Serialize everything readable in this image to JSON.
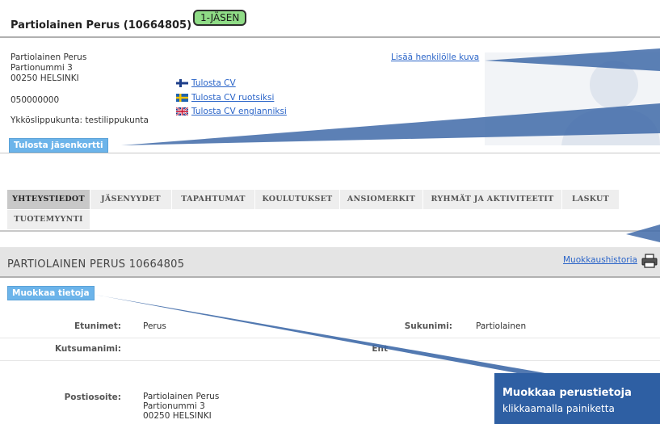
{
  "header": {
    "title": "Partiolainen Perus (10664805)",
    "badge": "1-JÄSEN"
  },
  "contact": {
    "name": "Partiolainen Perus",
    "street": "Partionummi 3",
    "postal": "00250 HELSINKI",
    "phone": "050000000",
    "unit": "Ykköslippukunta: testilippukunta"
  },
  "cv_links": [
    {
      "label": "Tulosta CV",
      "flag": "finland-flag-icon"
    },
    {
      "label": "Tulosta CV ruotsiksi",
      "flag": "sweden-flag-icon"
    },
    {
      "label": "Tulosta CV englanniksi",
      "flag": "uk-flag-icon"
    }
  ],
  "photo_link": "Lisää henkilölle kuva",
  "print_card_button": "Tulosta jäsenkortti",
  "tabs": [
    {
      "label": "YHTEYSTIEDOT",
      "active": true
    },
    {
      "label": "JÄSENYYDET"
    },
    {
      "label": "TAPAHTUMAT"
    },
    {
      "label": "KOULUTUKSET"
    },
    {
      "label": "ANSIOMERKIT"
    },
    {
      "label": "RYHMÄT JA AKTIVITEETIT"
    },
    {
      "label": "LASKUT"
    },
    {
      "label": "TUOTEMYYNTI"
    }
  ],
  "section": {
    "title": "PARTIOLAINEN PERUS  10664805",
    "history_link": "Muokkaushistoria",
    "edit_button": "Muokkaa tietoja"
  },
  "fields": {
    "etunimet_label": "Etunimet:",
    "etunimet_value": "Perus",
    "sukunimi_label": "Sukunimi:",
    "sukunimi_value": "Partiolainen",
    "kutsumanimi_label": "Kutsumanimi:",
    "entinen_label": "Ent",
    "postiosoite_label": "Postiosoite:",
    "postiosoite_name": "Partiolainen Perus",
    "postiosoite_street": "Partionummi 3",
    "postiosoite_postal": "00250 HELSINKI"
  },
  "callout": {
    "line1": "Muokkaa perustietoja",
    "line2": "klikkaamalla painiketta"
  },
  "colors": {
    "accent": "#6cb4ea",
    "callout": "#2e5fa3",
    "link": "#2a64c8",
    "badge": "#8fdc86"
  }
}
